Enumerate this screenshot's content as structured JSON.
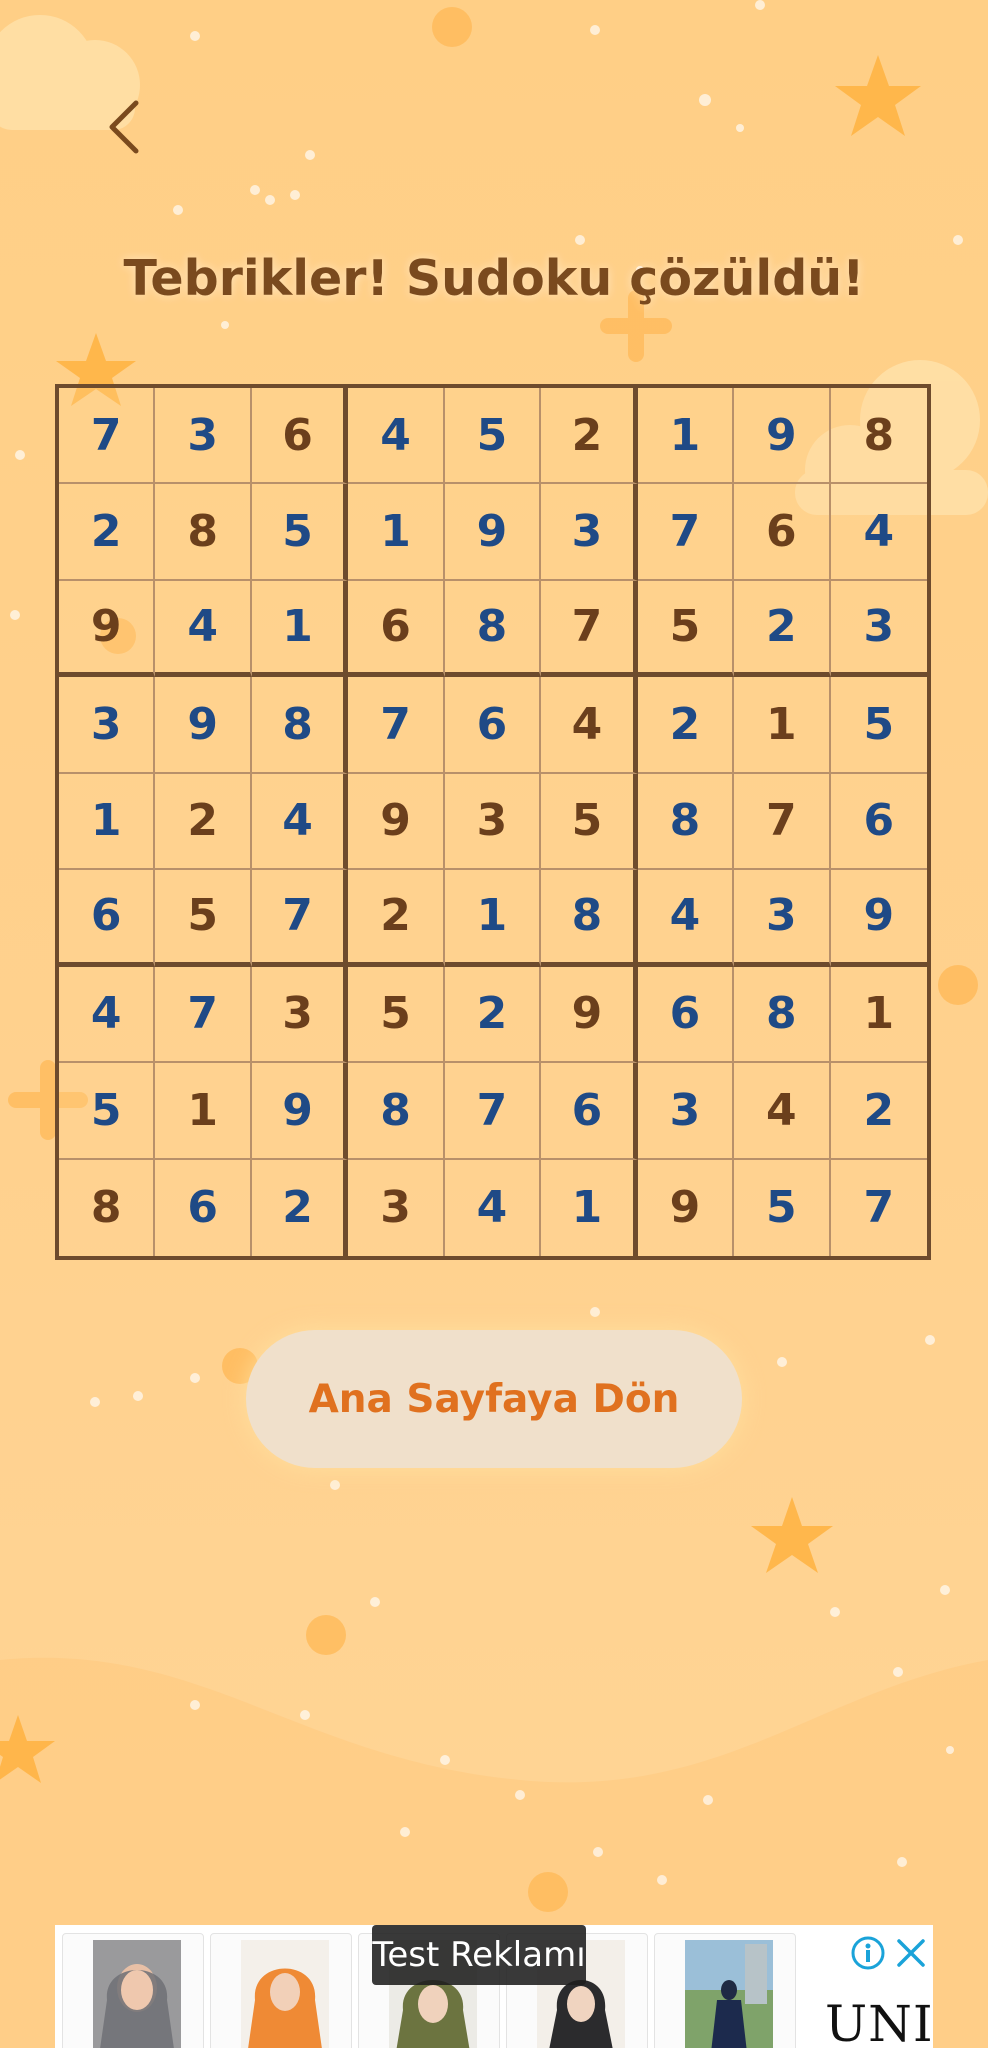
{
  "screen": {
    "title": "Tebrikler! Sudoku çözüldü!",
    "home_button_label": "Ana Sayfaya Dön"
  },
  "icons": {
    "back": "chevron-left-icon",
    "ad_info": "info-icon",
    "ad_close": "close-icon"
  },
  "colors": {
    "background": "#ffd089",
    "title": "#7a4a1e",
    "given_digit": "#6b3f1c",
    "solved_digit": "#1f4a86",
    "grid_line": "#6e4b2d",
    "home_button_bg": "#f0e0cb",
    "home_button_text": "#e0711f"
  },
  "board": {
    "rows": [
      [
        {
          "v": "7",
          "k": "solved"
        },
        {
          "v": "3",
          "k": "solved"
        },
        {
          "v": "6",
          "k": "given"
        },
        {
          "v": "4",
          "k": "solved"
        },
        {
          "v": "5",
          "k": "solved"
        },
        {
          "v": "2",
          "k": "given"
        },
        {
          "v": "1",
          "k": "solved"
        },
        {
          "v": "9",
          "k": "solved"
        },
        {
          "v": "8",
          "k": "given"
        }
      ],
      [
        {
          "v": "2",
          "k": "solved"
        },
        {
          "v": "8",
          "k": "given"
        },
        {
          "v": "5",
          "k": "solved"
        },
        {
          "v": "1",
          "k": "solved"
        },
        {
          "v": "9",
          "k": "solved"
        },
        {
          "v": "3",
          "k": "solved"
        },
        {
          "v": "7",
          "k": "solved"
        },
        {
          "v": "6",
          "k": "given"
        },
        {
          "v": "4",
          "k": "solved"
        }
      ],
      [
        {
          "v": "9",
          "k": "given"
        },
        {
          "v": "4",
          "k": "solved"
        },
        {
          "v": "1",
          "k": "solved"
        },
        {
          "v": "6",
          "k": "given"
        },
        {
          "v": "8",
          "k": "solved"
        },
        {
          "v": "7",
          "k": "given"
        },
        {
          "v": "5",
          "k": "given"
        },
        {
          "v": "2",
          "k": "solved"
        },
        {
          "v": "3",
          "k": "solved"
        }
      ],
      [
        {
          "v": "3",
          "k": "solved"
        },
        {
          "v": "9",
          "k": "solved"
        },
        {
          "v": "8",
          "k": "solved"
        },
        {
          "v": "7",
          "k": "solved"
        },
        {
          "v": "6",
          "k": "solved"
        },
        {
          "v": "4",
          "k": "given"
        },
        {
          "v": "2",
          "k": "solved"
        },
        {
          "v": "1",
          "k": "given"
        },
        {
          "v": "5",
          "k": "solved"
        }
      ],
      [
        {
          "v": "1",
          "k": "solved"
        },
        {
          "v": "2",
          "k": "given"
        },
        {
          "v": "4",
          "k": "solved"
        },
        {
          "v": "9",
          "k": "given"
        },
        {
          "v": "3",
          "k": "given"
        },
        {
          "v": "5",
          "k": "given"
        },
        {
          "v": "8",
          "k": "solved"
        },
        {
          "v": "7",
          "k": "given"
        },
        {
          "v": "6",
          "k": "solved"
        }
      ],
      [
        {
          "v": "6",
          "k": "solved"
        },
        {
          "v": "5",
          "k": "given"
        },
        {
          "v": "7",
          "k": "solved"
        },
        {
          "v": "2",
          "k": "given"
        },
        {
          "v": "1",
          "k": "solved"
        },
        {
          "v": "8",
          "k": "solved"
        },
        {
          "v": "4",
          "k": "solved"
        },
        {
          "v": "3",
          "k": "solved"
        },
        {
          "v": "9",
          "k": "solved"
        }
      ],
      [
        {
          "v": "4",
          "k": "solved"
        },
        {
          "v": "7",
          "k": "solved"
        },
        {
          "v": "3",
          "k": "given"
        },
        {
          "v": "5",
          "k": "given"
        },
        {
          "v": "2",
          "k": "solved"
        },
        {
          "v": "9",
          "k": "given"
        },
        {
          "v": "6",
          "k": "solved"
        },
        {
          "v": "8",
          "k": "solved"
        },
        {
          "v": "1",
          "k": "given"
        }
      ],
      [
        {
          "v": "5",
          "k": "solved"
        },
        {
          "v": "1",
          "k": "given"
        },
        {
          "v": "9",
          "k": "solved"
        },
        {
          "v": "8",
          "k": "solved"
        },
        {
          "v": "7",
          "k": "solved"
        },
        {
          "v": "6",
          "k": "solved"
        },
        {
          "v": "3",
          "k": "solved"
        },
        {
          "v": "4",
          "k": "given"
        },
        {
          "v": "2",
          "k": "solved"
        }
      ],
      [
        {
          "v": "8",
          "k": "given"
        },
        {
          "v": "6",
          "k": "solved"
        },
        {
          "v": "2",
          "k": "solved"
        },
        {
          "v": "3",
          "k": "given"
        },
        {
          "v": "4",
          "k": "solved"
        },
        {
          "v": "1",
          "k": "solved"
        },
        {
          "v": "9",
          "k": "given"
        },
        {
          "v": "5",
          "k": "solved"
        },
        {
          "v": "7",
          "k": "solved"
        }
      ]
    ]
  },
  "ad": {
    "label": "Test Reklamı",
    "brand": "UNI"
  }
}
